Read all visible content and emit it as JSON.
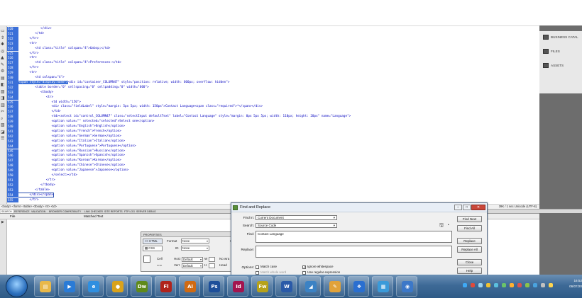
{
  "code": {
    "line_numbers": [
      "520",
      "521",
      "522",
      "523",
      "524",
      "525",
      "526",
      "527",
      "528",
      "529",
      "530",
      "531",
      "532",
      "533",
      "534",
      "535",
      "536",
      "537",
      "538",
      "539",
      "540",
      "541",
      "542",
      "543",
      "544",
      "545",
      "546",
      "547",
      "548",
      "549",
      "550",
      "551",
      "552",
      "553",
      "554",
      "555"
    ],
    "lines": [
      "            </div>",
      "         </td>",
      "      </tr>",
      "      <tr>",
      "         <td class=\"title\" colspan=\"4\">&nbsp;</td>",
      "      </tr>",
      "      <tr>",
      "         <td class=\"title\" colspan=\"4\">Preferences:</td>",
      "      </tr>",
      "      <tr>",
      "         <td colspan=\"4\">",
      "<span style=\"display:none\">",
      "         <table border=\"0\" cellspacing=\"0\" cellpadding=\"0\" width=\"600\">",
      "            <tbody>",
      "               <tr>",
      "                  <td width=\"150\">",
      "                  <div class=\"fieldLabel\" style=\"margin: 5px 5px; width: 150px\">Contact Language<span class=\"required\">*</span></div>",
      "                  </td>",
      "                  <td><select id=\"control_COLUMN47\" class=\"selectInput defaultText\" label=\"Contact Language\" style=\"margin: 0px 5px 5px; width: 110px; height: 20px\" name=\"Language\">",
      "                  <option value=\"\" selected=\"selected\">Select one</option>",
      "                  <option value=\"English\">English</option>",
      "                  <option value=\"French\">French</option>",
      "                  <option value=\"German\">German</option>",
      "                  <option value=\"Italian\">Italian</option>",
      "                  <option value=\"Portuguese\">Portuguese</option>",
      "                  <option value=\"Russian\">Russian</option>",
      "                  <option value=\"Spanish\">Spanish</option>",
      "                  <option value=\"Korean\">Korean</option>",
      "                  <option value=\"Chinese\">Chinese</option>",
      "                  <option value=\"Japanese\">Japanese</option>",
      "                  </select></td>",
      "               </tr>",
      "            </tbody>",
      "         </table>",
      "      </div></span>",
      "      </tr>"
    ],
    "line_531_tail": "<div id=\"container_COLUMN47\" style=\"position: relative; width: 600px; overflow: hidden\">"
  },
  "statusbar": {
    "path": "<body> <form> <table> <tbody> <tr> <td>",
    "right": "39K / 1 sec  Unicode (UTF-8)"
  },
  "tabs": [
    "SEARCH",
    "REFERENCE",
    "VALIDATION",
    "BROWSER COMPATIBILITY",
    "LINK CHECKER",
    "SITE REPORTS",
    "FTP LOG",
    "SERVER DEBUG"
  ],
  "results": {
    "file_header": "File",
    "matched_header": "Matched Text"
  },
  "properties": {
    "title": "PROPERTIES",
    "html_label": "HTML",
    "css_label": "CSS",
    "format_label": "Format",
    "format_value": "None",
    "id_label": "ID",
    "id_value": "None",
    "class_label": "Class",
    "link_label": "Link",
    "cell_label": "Cell",
    "horz_label": "Horz",
    "horz_value": "Default",
    "vert_label": "Vert",
    "vert_value": "Default",
    "w_label": "W",
    "h_label": "H",
    "no_wrap_label": "No wra",
    "header_label": "Head"
  },
  "dialog": {
    "title": "Find and Replace",
    "find_in_label": "Find in:",
    "find_in_value": "Current Document",
    "search_label": "Search:",
    "search_value": "Source Code",
    "find_label": "Find:",
    "find_value": "Contact Language",
    "replace_label": "Replace:",
    "replace_value": "",
    "options_label": "Options:",
    "match_case": "Match case",
    "match_whole_word": "Match whole word",
    "ignore_whitespace": "Ignore whitespace",
    "use_regex": "Use regular expression",
    "find_next": "Find Next",
    "find_all": "Find All",
    "replace_btn": "Replace",
    "replace_all": "Replace All",
    "close": "Close",
    "help": "Help"
  },
  "right_panel": {
    "items": [
      "BUSINESS CATAL",
      "FILES",
      "ASSETS"
    ]
  },
  "taskbar": {
    "apps": [
      {
        "name": "explorer",
        "glyph": "▤",
        "color": "#e8b84a"
      },
      {
        "name": "media",
        "glyph": "▶",
        "color": "#2a7bd6"
      },
      {
        "name": "ie",
        "glyph": "e",
        "color": "#2f8fe0"
      },
      {
        "name": "chrome",
        "glyph": "●",
        "color": "#d9a21b"
      },
      {
        "name": "dw",
        "glyph": "Dw",
        "color": "#5f8a1a"
      },
      {
        "name": "fl",
        "glyph": "Fl",
        "color": "#b0231c"
      },
      {
        "name": "ai",
        "glyph": "Ai",
        "color": "#d06a12"
      },
      {
        "name": "ps",
        "glyph": "Ps",
        "color": "#1d4f9a"
      },
      {
        "name": "id",
        "glyph": "Id",
        "color": "#a3154f"
      },
      {
        "name": "fw",
        "glyph": "Fw",
        "color": "#b6a21a"
      },
      {
        "name": "word",
        "glyph": "W",
        "color": "#2a5aa8"
      },
      {
        "name": "tool",
        "glyph": "◢",
        "color": "#3b82c4"
      },
      {
        "name": "paint",
        "glyph": "✎",
        "color": "#e0a23a"
      },
      {
        "name": "dw2",
        "glyph": "❖",
        "color": "#2a6fd0"
      },
      {
        "name": "tool2",
        "glyph": "▦",
        "color": "#3a9ad9"
      },
      {
        "name": "chrome2",
        "glyph": "◉",
        "color": "#3c78c8"
      }
    ],
    "time": "16:52",
    "date": "06/07/20"
  }
}
